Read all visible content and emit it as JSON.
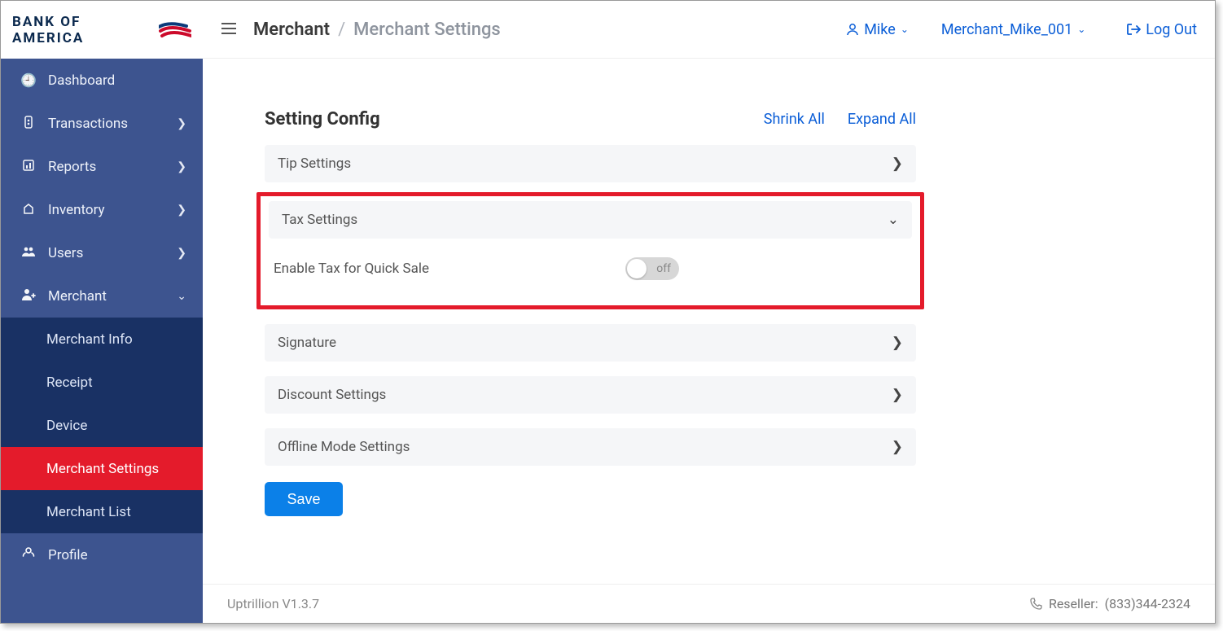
{
  "logo_text": "BANK OF AMERICA",
  "breadcrumb": {
    "item1": "Merchant",
    "sep": "/",
    "item2": "Merchant Settings"
  },
  "topbar": {
    "user_name": "Mike",
    "merchant_id": "Merchant_Mike_001",
    "logout": "Log Out"
  },
  "sidebar": {
    "items": [
      {
        "icon": "dashboard",
        "label": "Dashboard",
        "expandable": false
      },
      {
        "icon": "transactions",
        "label": "Transactions",
        "expandable": true
      },
      {
        "icon": "reports",
        "label": "Reports",
        "expandable": true
      },
      {
        "icon": "inventory",
        "label": "Inventory",
        "expandable": true
      },
      {
        "icon": "users",
        "label": "Users",
        "expandable": true
      },
      {
        "icon": "merchant",
        "label": "Merchant",
        "expandable": true,
        "expanded": true
      }
    ],
    "subitems": [
      {
        "label": "Merchant Info"
      },
      {
        "label": "Receipt"
      },
      {
        "label": "Device"
      },
      {
        "label": "Merchant Settings",
        "active": true
      },
      {
        "label": "Merchant List"
      }
    ],
    "profile": "Profile"
  },
  "card": {
    "title": "Setting Config",
    "shrink_all": "Shrink All",
    "expand_all": "Expand All",
    "tip_settings": "Tip Settings",
    "tax_settings": "Tax Settings",
    "enable_tax_label": "Enable Tax for Quick Sale",
    "toggle_state_text": "off",
    "signature": "Signature",
    "discount_settings": "Discount Settings",
    "offline_mode": "Offline Mode Settings",
    "save": "Save"
  },
  "footer": {
    "version": "Uptrillion V1.3.7",
    "reseller_label": "Reseller:",
    "reseller_phone": "(833)344-2324"
  }
}
